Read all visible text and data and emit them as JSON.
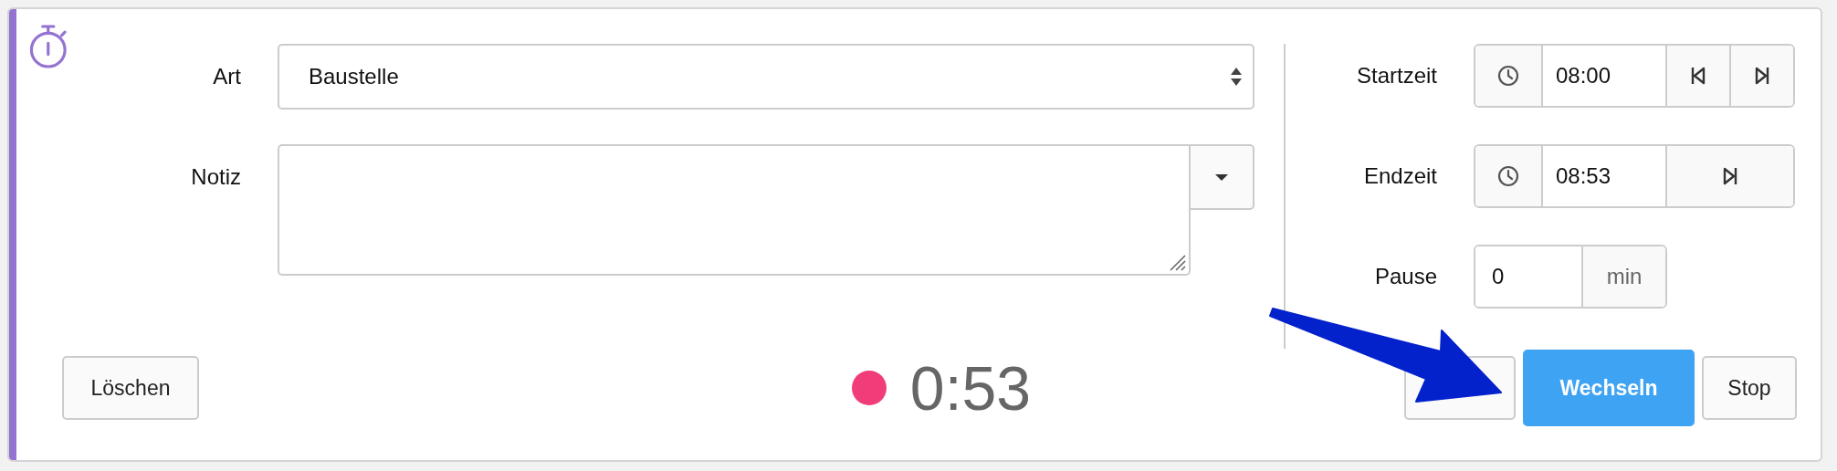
{
  "form": {
    "fields": [
      {
        "label": "Art",
        "kind": "select",
        "value": "Baustelle"
      },
      {
        "label": "Notiz",
        "kind": "textarea"
      }
    ]
  },
  "times": [
    {
      "label": "Startzeit",
      "kind": "time",
      "value": "08:00",
      "prev_button": true,
      "next_button": true
    },
    {
      "label": "Endzeit",
      "kind": "time",
      "value": "08:53",
      "prev_button": false,
      "next_button": true
    },
    {
      "label": "Pause",
      "kind": "duration",
      "value": "0",
      "unit": "min"
    }
  ],
  "footer": {
    "delete_button": "Löschen",
    "timer": {
      "recording": true,
      "elapsed": "0:53"
    },
    "buttons": [
      {
        "kind": "default"
      },
      {
        "label": "Wechseln",
        "kind": "primary"
      },
      {
        "label": "Stop",
        "kind": "default"
      }
    ]
  },
  "annotation": {
    "kind": "arrow"
  }
}
